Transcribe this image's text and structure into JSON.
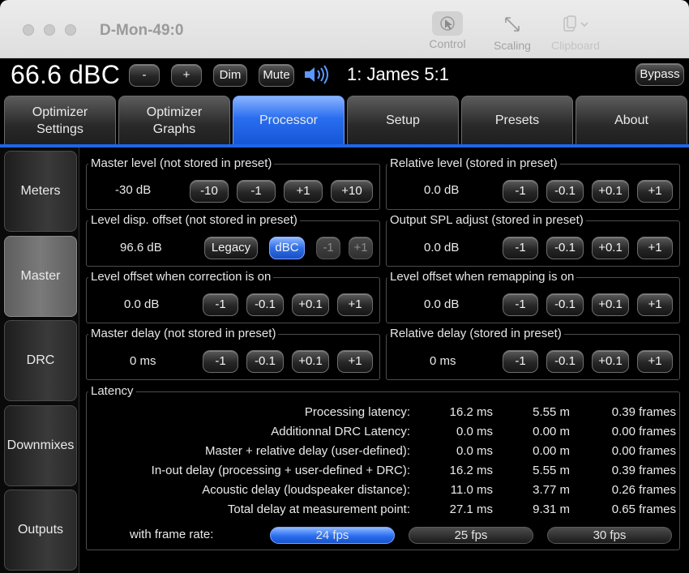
{
  "window": {
    "title": "D-Mon-49:0",
    "toolbar": [
      {
        "label": "Control",
        "icon": "cursor-icon"
      },
      {
        "label": "Scaling",
        "icon": "scaling-arrows-icon"
      },
      {
        "label": "Clipboard",
        "icon": "clipboard-icon"
      }
    ]
  },
  "top": {
    "level": "66.6 dBC",
    "minus": "-",
    "plus": "+",
    "dim": "Dim",
    "mute": "Mute",
    "preset_name": "1: James 5:1",
    "bypass": "Bypass"
  },
  "tabs": [
    {
      "line1": "Optimizer",
      "line2": "Settings"
    },
    {
      "line1": "Optimizer",
      "line2": "Graphs"
    },
    {
      "line1": "Processor",
      "line2": ""
    },
    {
      "line1": "Setup",
      "line2": ""
    },
    {
      "line1": "Presets",
      "line2": ""
    },
    {
      "line1": "About",
      "line2": ""
    }
  ],
  "active_tab": "Processor",
  "sidenav": [
    "Meters",
    "Master",
    "DRC",
    "Downmixes",
    "Outputs"
  ],
  "active_side": "Master",
  "groups": {
    "master_level": {
      "title": "Master level (not stored in preset)",
      "value": "-30 dB",
      "buttons": [
        "-10",
        "-1",
        "+1",
        "+10"
      ]
    },
    "relative_level": {
      "title": "Relative level (stored in preset)",
      "value": "0.0 dB",
      "buttons": [
        "-1",
        "-0.1",
        "+0.1",
        "+1"
      ]
    },
    "level_disp_offset": {
      "title": "Level disp. offset (not stored in preset)",
      "value": "96.6 dB",
      "buttons": [
        "Legacy",
        "dBC",
        "-1",
        "+1"
      ]
    },
    "output_spl": {
      "title": "Output SPL adjust (stored in preset)",
      "value": "0.0 dB",
      "buttons": [
        "-1",
        "-0.1",
        "+0.1",
        "+1"
      ]
    },
    "offset_correction": {
      "title": "Level offset when correction is on",
      "value": "0.0 dB",
      "buttons": [
        "-1",
        "-0.1",
        "+0.1",
        "+1"
      ]
    },
    "offset_remapping": {
      "title": "Level offset when remapping is on",
      "value": "0.0 dB",
      "buttons": [
        "-1",
        "-0.1",
        "+0.1",
        "+1"
      ]
    },
    "master_delay": {
      "title": "Master delay (not stored in preset)",
      "value": "0 ms",
      "buttons": [
        "-1",
        "-0.1",
        "+0.1",
        "+1"
      ]
    },
    "relative_delay": {
      "title": "Relative delay (stored in preset)",
      "value": "0 ms",
      "buttons": [
        "-1",
        "-0.1",
        "+0.1",
        "+1"
      ]
    }
  },
  "latency": {
    "title": "Latency",
    "rows": [
      {
        "label": "Processing latency:",
        "ms": "16.2 ms",
        "m": "5.55 m",
        "frames": "0.39 frames"
      },
      {
        "label": "Additionnal DRC Latency:",
        "ms": "0.0 ms",
        "m": "0.00 m",
        "frames": "0.00 frames"
      },
      {
        "label": "Master + relative delay (user-defined):",
        "ms": "0.0 ms",
        "m": "0.00 m",
        "frames": "0.00 frames"
      },
      {
        "label": "In-out delay (processing + user-defined + DRC):",
        "ms": "16.2 ms",
        "m": "5.55 m",
        "frames": "0.39 frames"
      },
      {
        "label": "Acoustic delay (loudspeaker distance):",
        "ms": "11.0 ms",
        "m": "3.77 m",
        "frames": "0.26 frames"
      },
      {
        "label": "Total delay at measurement point:",
        "ms": "27.1 ms",
        "m": "9.31 m",
        "frames": "0.65 frames"
      }
    ],
    "frame_rate_label": "with frame rate:",
    "frame_rates": [
      "24 fps",
      "25 fps",
      "30 fps"
    ],
    "active_frame_rate": "24 fps"
  },
  "colors": {
    "accent": "#1f66e8",
    "background": "#000000"
  }
}
